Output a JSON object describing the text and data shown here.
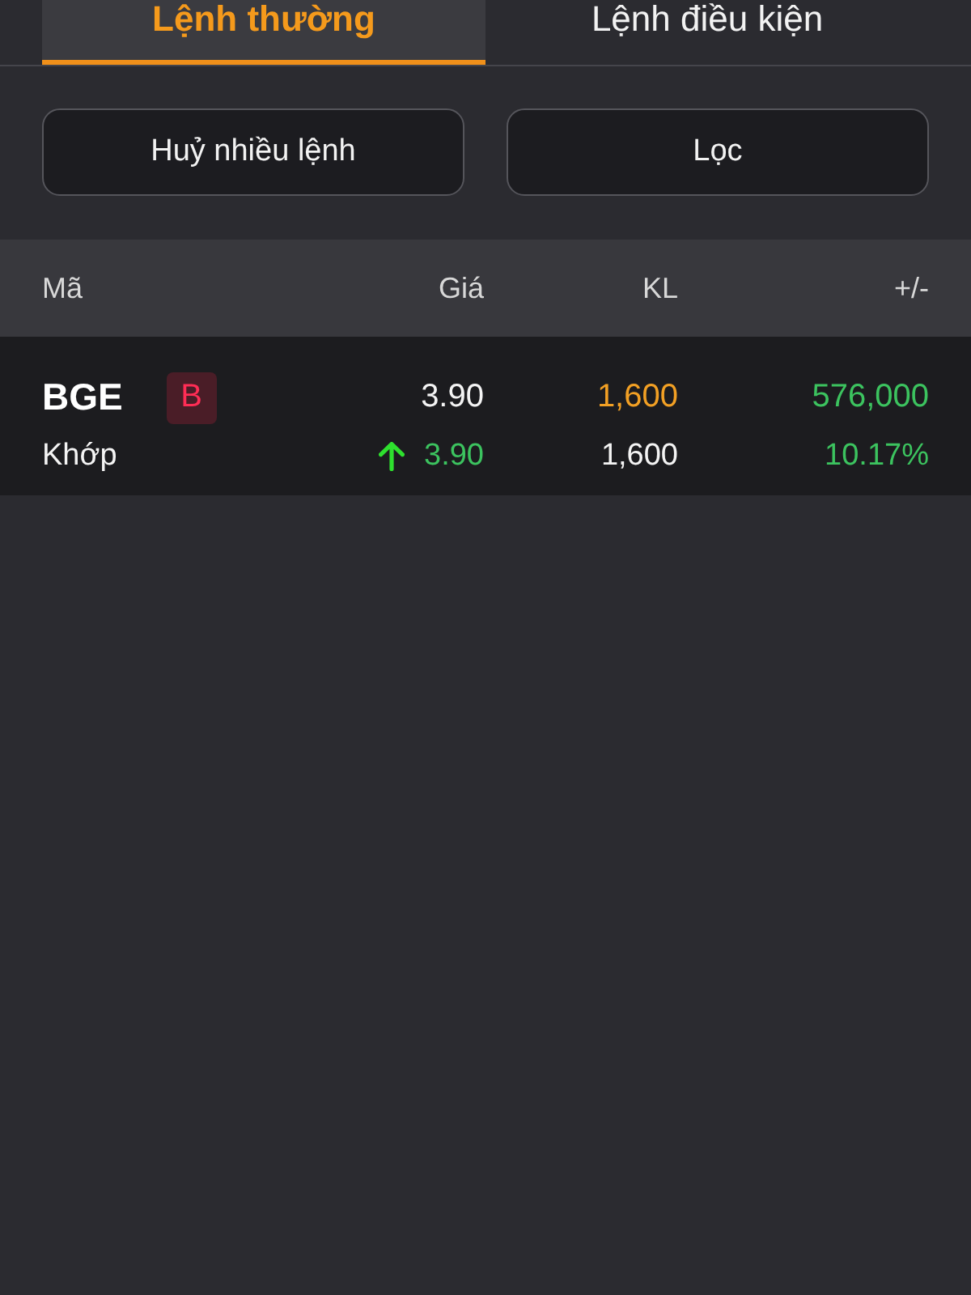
{
  "tabs": [
    {
      "label": "Lệnh thường",
      "selected": true
    },
    {
      "label": "Lệnh điều kiện",
      "selected": false
    }
  ],
  "buttons": [
    "Huỷ nhiều lệnh",
    "Lọc"
  ],
  "table": {
    "columns": [
      "Mã",
      "Giá",
      "KL",
      "+/-"
    ],
    "rows": [
      {
        "symbol": "BGE",
        "side": "B",
        "price": "3.90",
        "volume": "1,600",
        "change": "576,000",
        "status": "Khớp",
        "rising": true,
        "matched_price": "3.90",
        "matched_volume": "1,600",
        "change_percent": "10.17%"
      }
    ]
  }
}
